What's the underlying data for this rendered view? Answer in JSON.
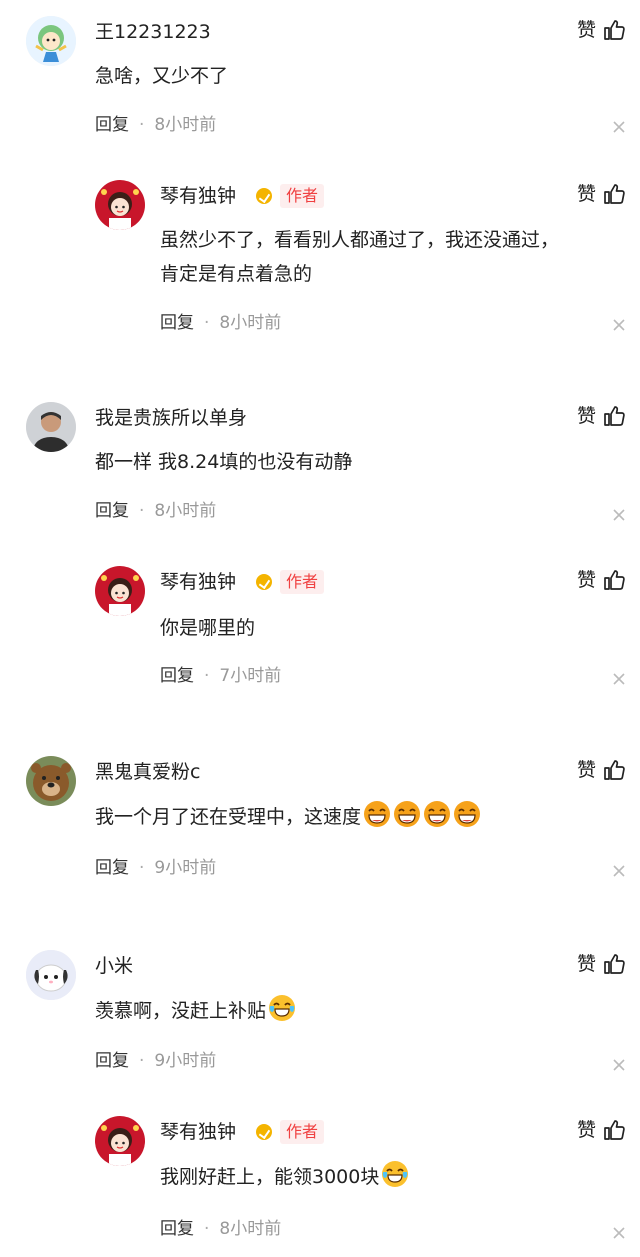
{
  "like_label": "赞",
  "reply_label": "回复",
  "dot": "·",
  "author_label": "作者",
  "comments": [
    {
      "name": "王12231223",
      "text": "急啥，又少不了",
      "time": "8小时前"
    },
    {
      "name": "琴有独钟",
      "text_lines": [
        "虽然少不了，看看别人都通过了，我还没通过，",
        "肯定是有点着急的"
      ],
      "time": "8小时前"
    },
    {
      "name": "我是贵族所以单身",
      "text": "都一样 我8.24填的也没有动静",
      "time": "8小时前"
    },
    {
      "name": "琴有独钟",
      "text": "你是哪里的",
      "time": "7小时前"
    },
    {
      "name": "黑鬼真爱粉c",
      "text": "我一个月了还在受理中，这速度",
      "time": "9小时前"
    },
    {
      "name": "小米",
      "text": "羡慕啊，没赶上补贴",
      "time": "9小时前"
    },
    {
      "name": "琴有独钟",
      "text": "我刚好赶上，能领3000块",
      "time": "8小时前"
    }
  ]
}
